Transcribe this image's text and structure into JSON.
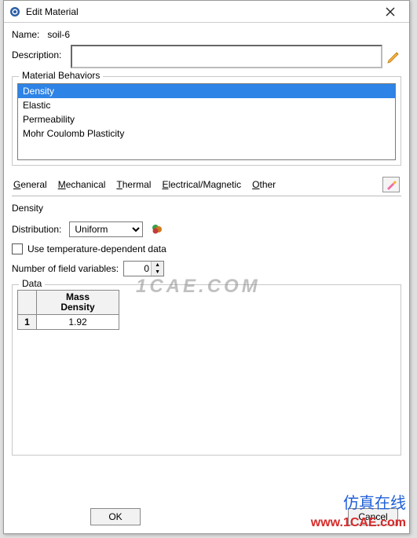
{
  "window": {
    "title": "Edit Material"
  },
  "name": {
    "label": "Name:",
    "value": "soil-6"
  },
  "description": {
    "label": "Description:",
    "value": ""
  },
  "behaviors": {
    "title": "Material Behaviors",
    "items": [
      "Density",
      "Elastic",
      "Permeability",
      "Mohr Coulomb Plasticity"
    ],
    "selected_index": 0
  },
  "tabs": {
    "general": "General",
    "mechanical": "Mechanical",
    "thermal": "Thermal",
    "electrical": "Electrical/Magnetic",
    "other": "Other"
  },
  "section": {
    "title": "Density"
  },
  "distribution": {
    "label": "Distribution:",
    "value": "Uniform"
  },
  "tempDep": {
    "label": "Use temperature-dependent data",
    "checked": false
  },
  "fieldVars": {
    "label": "Number of field variables:",
    "value": "0"
  },
  "dataGroup": {
    "title": "Data",
    "header1": "Mass",
    "header2": "Density",
    "rownum": "1",
    "cell": "1.92"
  },
  "buttons": {
    "ok": "OK",
    "cancel": "Cancel"
  },
  "watermarks": {
    "cae": "1CAE.COM",
    "fangzhen": "仿真在线",
    "url": "www.1CAE.com"
  }
}
